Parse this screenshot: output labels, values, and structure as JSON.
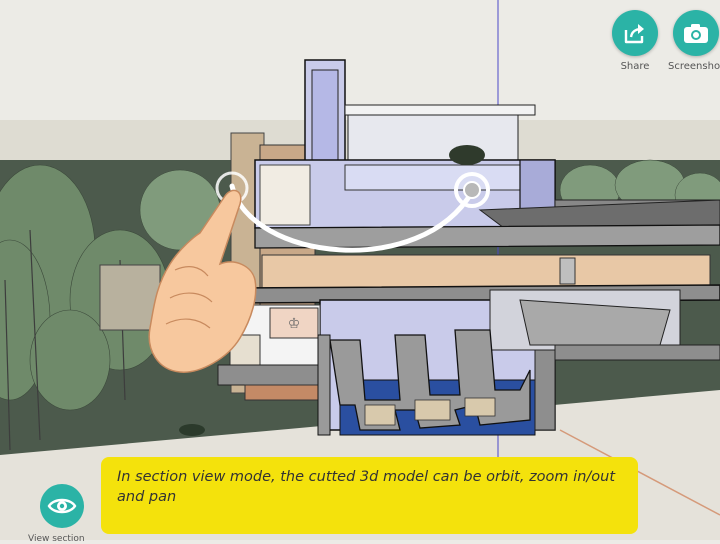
{
  "toolbar": {
    "share": {
      "label": "Share",
      "icon": "share-icon"
    },
    "screenshot": {
      "label": "Screenshot",
      "icon": "camera-icon"
    }
  },
  "caption": {
    "text": "In  section view mode, the cutted 3d model can be orbit, zoom in/out  and pan"
  },
  "view_section": {
    "label": "View section",
    "icon": "eye-icon"
  },
  "colors": {
    "accent": "#2bb3a6",
    "caption_bg": "#f4e20c",
    "section_fill": "#c9cbea",
    "ground": "#4c5a4c",
    "sky": "#ecebe6"
  }
}
